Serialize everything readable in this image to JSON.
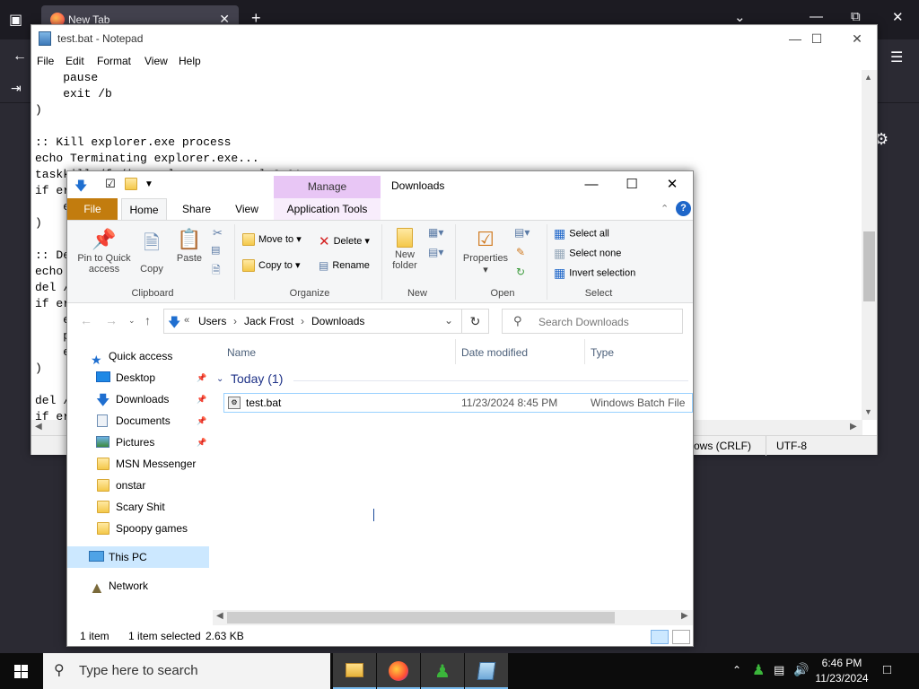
{
  "browser": {
    "tab_title": "New Tab",
    "new_tab_symbol": "+"
  },
  "notepad": {
    "title": "test.bat - Notepad",
    "menu": [
      "File",
      "Edit",
      "Format",
      "View",
      "Help"
    ],
    "content": "    pause\n    exit /b\n)\n\n:: Kill explorer.exe process\necho Terminating explorer.exe...\ntaskkill /f /im explorer.exe >nul 2>&1\nif errorlevel 1 (\n    echo\n)\n\n:: De\necho\ndel /\nif er\n    e\n    p\n    e\n)\n\ndel /\nif er",
    "status_encoding_eol": "ows (CRLF)",
    "status_charset": "UTF-8"
  },
  "explorer": {
    "window_title": "Downloads",
    "contextual_tab": "Manage",
    "tabs": [
      "File",
      "Home",
      "Share",
      "View",
      "Application Tools"
    ],
    "ribbon": {
      "clipboard": {
        "label": "Clipboard",
        "pin": "Pin to Quick access",
        "copy": "Copy",
        "paste": "Paste"
      },
      "organize": {
        "label": "Organize",
        "move_to": "Move to",
        "copy_to": "Copy to",
        "delete": "Delete",
        "rename": "Rename"
      },
      "new": {
        "label": "New",
        "new_folder": "New folder"
      },
      "open": {
        "label": "Open",
        "properties": "Properties"
      },
      "select": {
        "label": "Select",
        "select_all": "Select all",
        "select_none": "Select none",
        "invert": "Invert selection"
      }
    },
    "breadcrumb": [
      "Users",
      "Jack Frost",
      "Downloads"
    ],
    "search_placeholder": "Search Downloads",
    "nav": {
      "quick_access": "Quick access",
      "items": [
        "Desktop",
        "Downloads",
        "Documents",
        "Pictures",
        "MSN Messenger",
        "onstar",
        "Scary Shit",
        "Spoopy games"
      ],
      "this_pc": "This PC",
      "network": "Network"
    },
    "columns": [
      "Name",
      "Date modified",
      "Type"
    ],
    "group": "Today (1)",
    "files": [
      {
        "name": "test.bat",
        "date": "11/23/2024 8:45 PM",
        "type": "Windows Batch File"
      }
    ],
    "status": {
      "count": "1 item",
      "selected": "1 item selected",
      "size": "2.63 KB"
    }
  },
  "taskbar": {
    "search_placeholder": "Type here to search",
    "time": "6:46 PM",
    "date": "11/23/2024"
  }
}
